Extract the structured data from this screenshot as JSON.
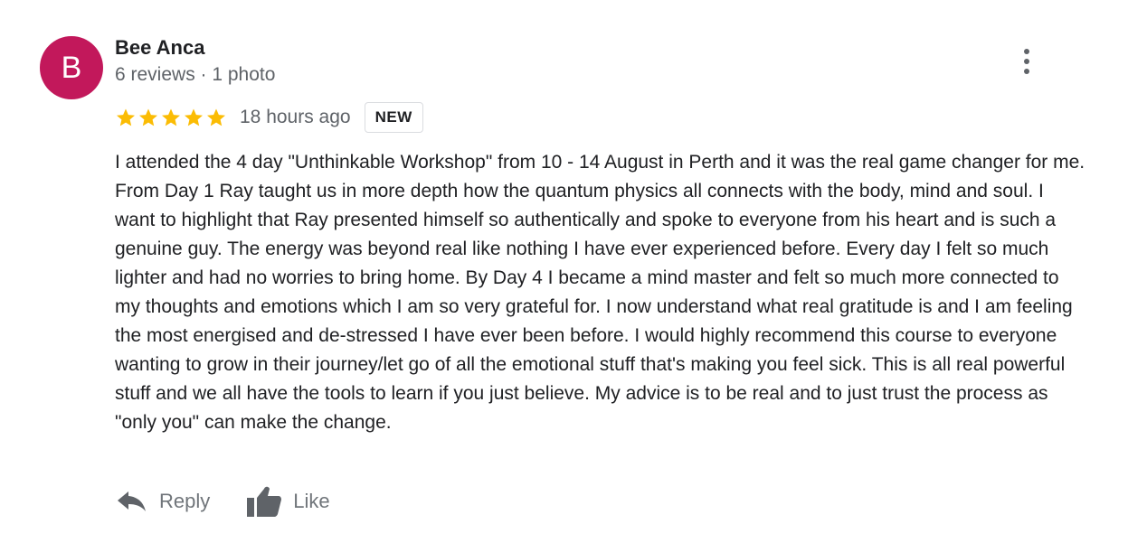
{
  "review": {
    "avatar_letter": "B",
    "avatar_color": "#c2185b",
    "author_name": "Bee Anca",
    "author_meta": "6 reviews · 1 photo",
    "rating": 5,
    "rating_max": 5,
    "star_color": "#fbbc04",
    "time": "18 hours ago",
    "badge": "NEW",
    "text": "I attended the 4 day \"Unthinkable Workshop\" from 10 - 14 August in Perth and it was the real game changer for me. From Day 1 Ray taught us in more depth how the quantum physics all connects with the body, mind and soul. I want to highlight that Ray presented himself so authentically and spoke to everyone from his heart and is such a genuine guy. The energy was beyond real like nothing I have ever experienced before. Every day I felt so much lighter and had no worries to bring home. By Day 4 I became a mind master and felt so much more connected to my thoughts and emotions which I am so very grateful for. I now understand what real gratitude is and I am feeling the most energised and de-stressed I have ever been before. I would highly recommend this course to everyone wanting to grow in their journey/let go of all the emotional stuff that's making you feel sick. This is all real powerful stuff and we all have the tools to learn if you just believe. My advice is to be real and to just trust the process as \"only you\" can make the change.",
    "more_icon": "more-vert-icon"
  },
  "actions": {
    "reply_label": "Reply",
    "reply_icon": "reply-arrow-icon",
    "like_label": "Like",
    "like_icon": "thumbs-up-icon"
  }
}
